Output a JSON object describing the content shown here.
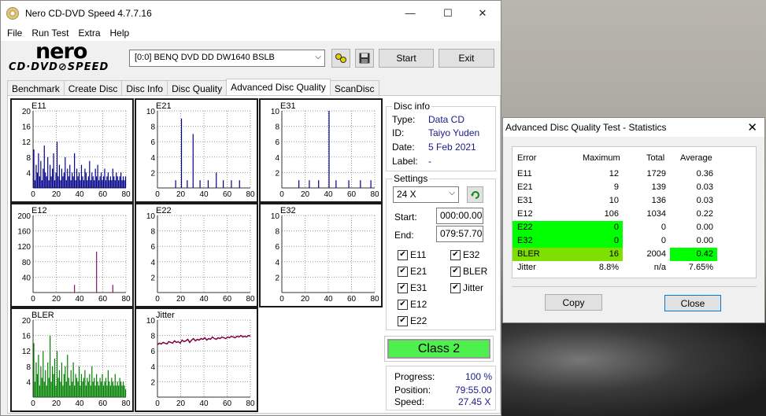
{
  "window": {
    "title": "Nero CD-DVD Speed 4.7.7.16",
    "minimize": "—",
    "maximize": "☐",
    "close": "✕"
  },
  "menu": [
    "File",
    "Run Test",
    "Extra",
    "Help"
  ],
  "logo": {
    "line1": "nero",
    "line2": "CD·DVD⊘SPEED"
  },
  "toolbar": {
    "drive": "[0:0]   BENQ DVD DD DW1640 BSLB",
    "start_label": "Start",
    "exit_label": "Exit"
  },
  "tabs": [
    "Benchmark",
    "Create Disc",
    "Disc Info",
    "Disc Quality",
    "Advanced Disc Quality",
    "ScanDisc"
  ],
  "active_tab": "Advanced Disc Quality",
  "disc_info": {
    "title": "Disc info",
    "type_label": "Type:",
    "type_value": "Data CD",
    "id_label": "ID:",
    "id_value": "Taiyo Yuden",
    "date_label": "Date:",
    "date_value": "5 Feb 2021",
    "label_label": "Label:",
    "label_value": "-"
  },
  "settings": {
    "title": "Settings",
    "speed": "24 X",
    "start_label": "Start:",
    "start_value": "000:00.00",
    "end_label": "End:",
    "end_value": "079:57.70",
    "checks": [
      "E11",
      "E32",
      "E21",
      "BLER",
      "E31",
      "Jitter",
      "E12",
      "E22"
    ]
  },
  "class_label": "Class 2",
  "progress": {
    "progress_label": "Progress:",
    "progress_value": "100 %",
    "position_label": "Position:",
    "position_value": "79:55.00",
    "speed_label": "Speed:",
    "speed_value": "27.45 X"
  },
  "chart_data": [
    {
      "type": "bar",
      "title": "E11",
      "ylim": [
        0,
        20
      ],
      "yticks": [
        4,
        8,
        12,
        16,
        20
      ],
      "xticks": [
        0,
        20,
        40,
        60,
        80
      ],
      "color": "#00008b",
      "values": [
        10,
        2,
        6,
        4,
        9,
        3,
        7,
        2,
        5,
        11,
        4,
        3,
        8,
        2,
        6,
        3,
        5,
        9,
        2,
        4,
        12,
        3,
        6,
        2,
        5,
        3,
        4,
        8,
        2,
        5,
        3,
        6,
        2,
        4,
        3,
        9,
        2,
        5,
        3,
        4,
        2,
        6,
        3,
        2,
        5,
        4,
        2,
        3,
        7,
        2,
        4,
        3,
        2,
        5,
        3,
        6,
        2,
        3,
        4,
        2,
        3,
        5,
        2,
        3,
        4,
        2,
        3,
        2,
        5,
        3,
        2,
        4,
        3,
        2,
        3,
        4,
        2,
        3,
        2,
        3
      ]
    },
    {
      "type": "bar",
      "title": "E21",
      "ylim": [
        0,
        10
      ],
      "yticks": [
        2,
        4,
        6,
        8,
        10
      ],
      "xticks": [
        0,
        20,
        40,
        60,
        80
      ],
      "color": "#00008b",
      "values": [
        0,
        0,
        0,
        0,
        0,
        0,
        0,
        0,
        0,
        0,
        0,
        0,
        0,
        0,
        0,
        1,
        0,
        0,
        0,
        0,
        9,
        0,
        0,
        0,
        0,
        1,
        0,
        0,
        0,
        0,
        7,
        0,
        0,
        0,
        0,
        0,
        1,
        0,
        0,
        0,
        0,
        0,
        0,
        1,
        0,
        0,
        0,
        0,
        0,
        0,
        2,
        0,
        0,
        0,
        0,
        0,
        1,
        0,
        0,
        0,
        0,
        0,
        0,
        1,
        0,
        0,
        0,
        0,
        0,
        0,
        1,
        0,
        0,
        0,
        0,
        0,
        0,
        0,
        0,
        0
      ]
    },
    {
      "type": "bar",
      "title": "E31",
      "ylim": [
        0,
        10
      ],
      "yticks": [
        2,
        4,
        6,
        8,
        10
      ],
      "xticks": [
        0,
        20,
        40,
        60,
        80
      ],
      "color": "#00008b",
      "values": [
        0,
        0,
        0,
        0,
        0,
        0,
        0,
        0,
        0,
        0,
        0,
        0,
        0,
        0,
        1,
        0,
        0,
        0,
        0,
        0,
        0,
        0,
        0,
        1,
        0,
        0,
        0,
        0,
        0,
        0,
        0,
        1,
        0,
        0,
        0,
        0,
        0,
        0,
        0,
        0,
        10,
        0,
        0,
        0,
        0,
        0,
        1,
        0,
        0,
        0,
        0,
        0,
        0,
        0,
        0,
        0,
        0,
        1,
        0,
        0,
        0,
        0,
        0,
        0,
        0,
        0,
        0,
        1,
        0,
        0,
        0,
        0,
        0,
        0,
        0,
        0,
        1,
        0,
        0,
        0
      ]
    },
    {
      "type": "bar",
      "title": "E12",
      "ylim": [
        0,
        200
      ],
      "yticks": [
        40,
        80,
        120,
        160,
        200
      ],
      "xticks": [
        0,
        20,
        40,
        60,
        80
      ],
      "color": "#7a1a6e",
      "values": [
        0,
        0,
        0,
        0,
        0,
        0,
        0,
        0,
        0,
        0,
        0,
        0,
        0,
        0,
        0,
        0,
        0,
        0,
        0,
        0,
        0,
        0,
        0,
        0,
        0,
        0,
        0,
        0,
        0,
        0,
        0,
        0,
        0,
        0,
        0,
        20,
        0,
        0,
        0,
        0,
        0,
        0,
        0,
        0,
        0,
        0,
        0,
        0,
        0,
        0,
        0,
        0,
        0,
        0,
        106,
        0,
        0,
        0,
        0,
        0,
        0,
        0,
        0,
        0,
        0,
        0,
        0,
        0,
        20,
        0,
        0,
        0,
        0,
        0,
        0,
        0,
        0,
        0,
        0,
        0
      ]
    },
    {
      "type": "bar",
      "title": "E22",
      "ylim": [
        0,
        10
      ],
      "yticks": [
        2,
        4,
        6,
        8,
        10
      ],
      "xticks": [
        0,
        20,
        40,
        60,
        80
      ],
      "color": "#00008b",
      "values": []
    },
    {
      "type": "bar",
      "title": "E32",
      "ylim": [
        0,
        10
      ],
      "yticks": [
        2,
        4,
        6,
        8,
        10
      ],
      "xticks": [
        0,
        20,
        40,
        60,
        80
      ],
      "color": "#00008b",
      "values": []
    },
    {
      "type": "bar",
      "title": "BLER",
      "ylim": [
        0,
        20
      ],
      "yticks": [
        4,
        8,
        12,
        16,
        20
      ],
      "xticks": [
        0,
        20,
        40,
        60,
        80
      ],
      "color": "#008000",
      "values": [
        14,
        4,
        9,
        6,
        11,
        3,
        8,
        5,
        12,
        4,
        7,
        3,
        9,
        5,
        16,
        4,
        8,
        6,
        10,
        3,
        12,
        5,
        7,
        4,
        9,
        3,
        6,
        8,
        4,
        11,
        5,
        3,
        7,
        4,
        9,
        3,
        6,
        5,
        4,
        8,
        3,
        6,
        4,
        5,
        7,
        3,
        5,
        4,
        6,
        3,
        8,
        4,
        5,
        3,
        6,
        4,
        3,
        5,
        4,
        6,
        3,
        4,
        5,
        3,
        7,
        4,
        3,
        5,
        4,
        3,
        6,
        3,
        4,
        3,
        5,
        4,
        3,
        4,
        3,
        2
      ]
    },
    {
      "type": "line",
      "title": "Jitter",
      "ylim": [
        0,
        10
      ],
      "yticks": [
        2,
        4,
        6,
        8,
        10
      ],
      "xticks": [
        0,
        20,
        40,
        60,
        80
      ],
      "color": "#800040",
      "values": [
        6.8,
        7.0,
        6.9,
        7.1,
        7.0,
        6.9,
        7.2,
        7.1,
        7.0,
        7.3,
        7.1,
        7.2,
        7.0,
        7.4,
        7.2,
        7.3,
        7.5,
        7.1,
        7.4,
        7.6,
        7.3,
        7.5,
        7.4,
        7.6,
        7.5,
        7.7,
        7.4,
        7.6,
        7.5,
        7.8,
        7.6,
        7.5,
        7.7,
        7.6,
        7.8,
        7.7,
        7.6,
        7.8,
        7.7,
        7.9,
        7.8,
        7.7,
        7.9,
        7.8,
        8.0,
        7.8,
        7.9,
        7.8,
        8.0,
        7.9
      ]
    }
  ],
  "stats": {
    "title": "Advanced Disc Quality Test - Statistics",
    "close_x": "✕",
    "headers": [
      "Error",
      "Maximum",
      "Total",
      "Average"
    ],
    "rows": [
      [
        "E11",
        "12",
        "1729",
        "0.36"
      ],
      [
        "E21",
        "9",
        "139",
        "0.03"
      ],
      [
        "E31",
        "10",
        "136",
        "0.03"
      ],
      [
        "E12",
        "106",
        "1034",
        "0.22"
      ],
      [
        "E22",
        "0",
        "0",
        "0.00"
      ],
      [
        "E32",
        "0",
        "0",
        "0.00"
      ],
      [
        "BLER",
        "16",
        "2004",
        "0.42"
      ],
      [
        "Jitter",
        "8.8%",
        "n/a",
        "7.65%"
      ]
    ],
    "copy_label": "Copy",
    "close_label": "Close",
    "highlight_green": "#00ff00",
    "highlight_lime": "#7fdf00"
  }
}
